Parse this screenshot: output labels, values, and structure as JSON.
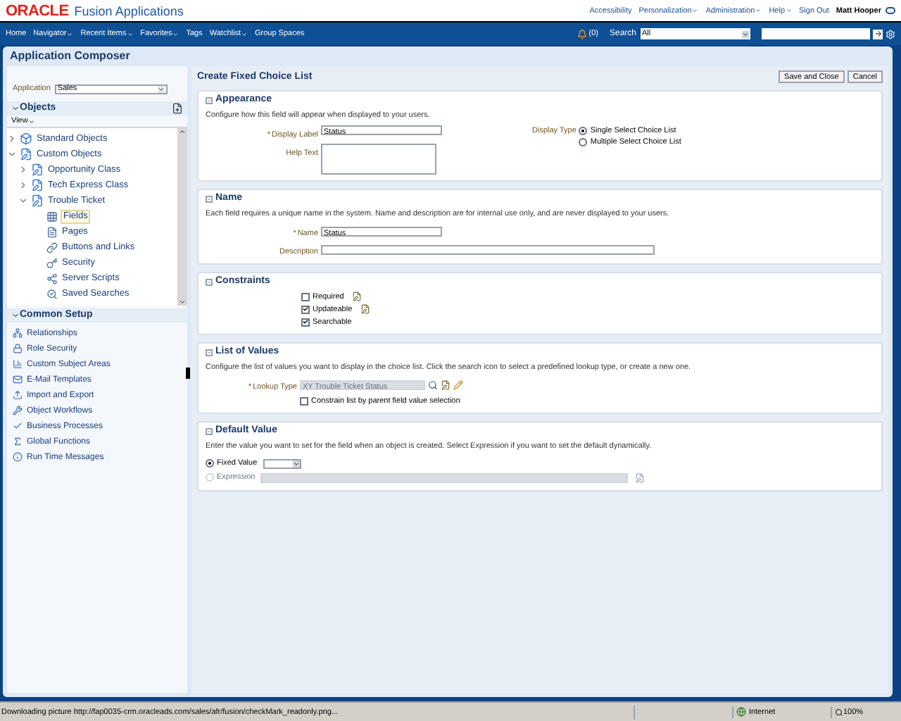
{
  "header": {
    "logo": "ORACLE",
    "product": "Fusion Applications",
    "links": [
      {
        "label": "Accessibility",
        "has_menu": false
      },
      {
        "label": "Personalization",
        "has_menu": true
      },
      {
        "label": "Administration",
        "has_menu": true
      },
      {
        "label": "Help",
        "has_menu": true
      },
      {
        "label": "Sign Out",
        "has_menu": false
      }
    ],
    "user": "Matt Hooper"
  },
  "navbar": {
    "items": [
      {
        "label": "Home",
        "has_menu": false
      },
      {
        "label": "Navigator",
        "has_menu": true
      },
      {
        "label": "Recent Items",
        "has_menu": true
      },
      {
        "label": "Favorites",
        "has_menu": true
      },
      {
        "label": "Tags",
        "has_menu": false
      },
      {
        "label": "Watchlist",
        "has_menu": true
      },
      {
        "label": "Group Spaces",
        "has_menu": false
      }
    ],
    "notifications": "(0)",
    "search_label": "Search",
    "search_scope": "All"
  },
  "page_title": "Application Composer",
  "sidebar": {
    "application_label": "Application",
    "application_value": "Sales",
    "objects_title": "Objects",
    "view_menu": "View",
    "tree": [
      {
        "label": "Standard Objects",
        "expanded": false,
        "selected": false
      },
      {
        "label": "Custom Objects",
        "expanded": true,
        "selected": false,
        "children": [
          {
            "label": "Opportunity Class",
            "expanded": false,
            "selected": false
          },
          {
            "label": "Tech Express Class",
            "expanded": false,
            "selected": false
          },
          {
            "label": "Trouble Ticket",
            "expanded": true,
            "selected": false,
            "children": [
              {
                "label": "Fields",
                "kind": "fields",
                "selected": true
              },
              {
                "label": "Pages",
                "kind": "pages",
                "selected": false
              },
              {
                "label": "Buttons and Links",
                "kind": "links",
                "selected": false
              },
              {
                "label": "Security",
                "kind": "security",
                "selected": false
              },
              {
                "label": "Server Scripts",
                "kind": "scripts",
                "selected": false
              },
              {
                "label": "Saved Searches",
                "kind": "searches",
                "selected": false
              }
            ]
          }
        ]
      }
    ],
    "common_setup_title": "Common Setup",
    "common_setup": [
      {
        "label": "Relationships",
        "kind": "relationships"
      },
      {
        "label": "Role Security",
        "kind": "lock"
      },
      {
        "label": "Custom Subject Areas",
        "kind": "areas"
      },
      {
        "label": "E-Mail Templates",
        "kind": "mail"
      },
      {
        "label": "Import and Export",
        "kind": "import"
      },
      {
        "label": "Object Workflows",
        "kind": "workflow"
      },
      {
        "label": "Business Processes",
        "kind": "check"
      },
      {
        "label": "Global Functions",
        "kind": "function"
      },
      {
        "label": "Run Time Messages",
        "kind": "info"
      }
    ]
  },
  "form": {
    "title": "Create Fixed Choice List",
    "buttons": [
      "Save and Close",
      "Cancel"
    ],
    "appearance": {
      "title": "Appearance",
      "description": "Configure how this field will appear when displayed to your users.",
      "display_label": {
        "label": "Display Label",
        "required_mark": "*",
        "value": "Status"
      },
      "help_text": {
        "label": "Help Text"
      },
      "display_type_label": "Display Type",
      "display_types": [
        {
          "label": "Single Select Choice List",
          "selected": true
        },
        {
          "label": "Multiple Select Choice List",
          "selected": false
        }
      ]
    },
    "name": {
      "title": "Name",
      "description": "Each field requires a unique name in the system. Name and description are for internal use only, and are never displayed to your users.",
      "name_field": {
        "label": "Name",
        "required_mark": "*",
        "value": "Status"
      },
      "description_field": {
        "label": "Description"
      }
    },
    "constraints": {
      "title": "Constraints",
      "items": [
        {
          "label": "Required",
          "checked": false,
          "expression_icon": true
        },
        {
          "label": "Updateable",
          "checked": true,
          "expression_icon": true
        },
        {
          "label": "Searchable",
          "checked": true,
          "expression_icon": false
        }
      ]
    },
    "list_of_values": {
      "title": "List of Values",
      "description": "Configure the list of values you want to display in the choice list. Click the search icon to select a predefined lookup type, or create a new one.",
      "lookup_type": {
        "label": "Lookup Type",
        "required_mark": "*",
        "value": "XY Trouble Ticket Status",
        "disabled": true
      },
      "constrain": {
        "label": "Constrain list by parent field value selection",
        "checked": false
      }
    },
    "default_value": {
      "title": "Default Value",
      "description": "Enter the value you want to set for the field when an object is created. Select Expression if you want to set the default dynamically.",
      "options": [
        {
          "label": "Fixed Value",
          "kind": "dropdown",
          "selected": true,
          "disabled": false
        },
        {
          "label": "Expression",
          "kind": "expression",
          "selected": false,
          "disabled": true
        }
      ]
    }
  },
  "status_bar": {
    "message": "Downloading picture http://fap0035-crm.oracleads.com/sales/afr/fusion/checkMark_readonly.png...",
    "zone": "Internet",
    "zoom": "100%"
  }
}
